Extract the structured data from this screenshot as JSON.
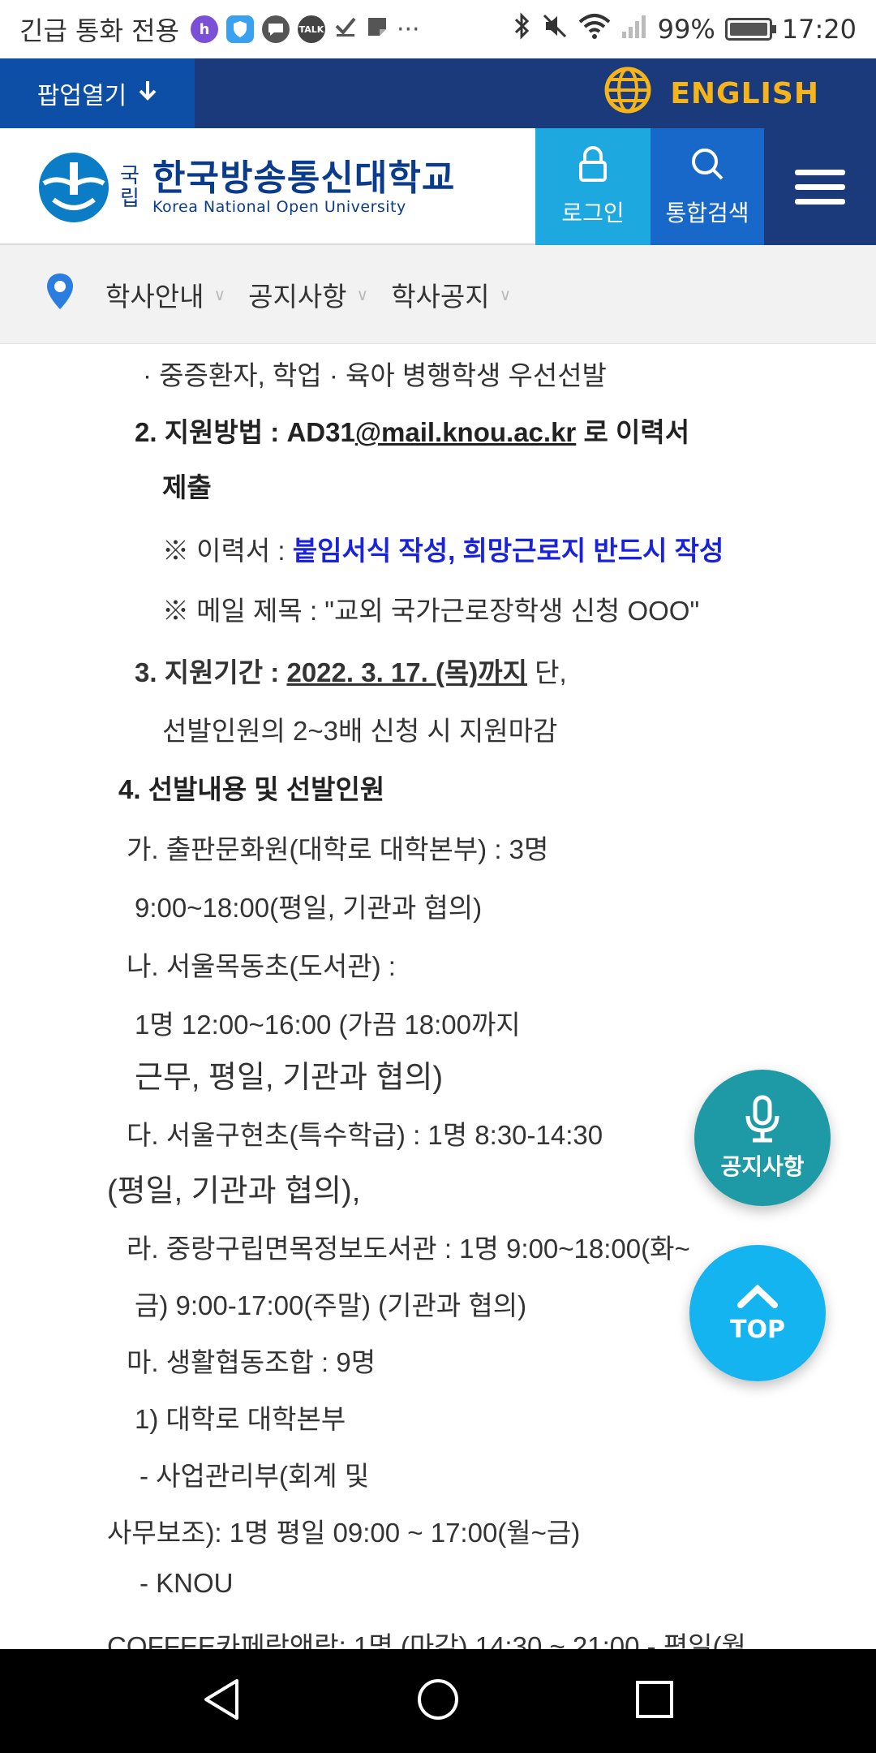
{
  "status_bar": {
    "carrier": "긴급 통화 전용",
    "battery": "99%",
    "time": "17:20",
    "battery_level": 0.99
  },
  "topbar": {
    "popup_label": "팝업열기",
    "english_label": "ENGLISH"
  },
  "header": {
    "logo_gukrip": "국립",
    "logo_name": "한국방송통신대학교",
    "logo_sub": "Korea National Open University",
    "login_label": "로그인",
    "search_label": "통합검색"
  },
  "breadcrumb": {
    "items": [
      "학사안내",
      "공지사항",
      "학사공지"
    ]
  },
  "content": {
    "l1": "· 중증환자, 학업 · 육아 병행학생 우선선발",
    "l2a": "2. 지원방법 : AD31",
    "l2b": "@mail.knou.ac.kr",
    "l2c": " 로 이력서",
    "l3": "제출",
    "l4a": "※ 이력서 : ",
    "l4b": "붙임서식 작성, 희망근로지 반드시 작성",
    "l5": "※ 메일 제목 : \"교외 국가근로장학생 신청 OOO\"",
    "l6a": "3. 지원기간 : ",
    "l6b": "2022. 3. 17. (목)까지",
    "l6c": " 단,",
    "l7": "선발인원의 2~3배 신청 시 지원마감",
    "l8": "4. 선발내용 및 선발인원",
    "l9": "가. 출판문화원(대학로 대학본부) : 3명",
    "l10": "9:00~18:00(평일, 기관과 협의)",
    "l11": "나. 서울목동초(도서관) :",
    "l12": "1명  12:00~16:00 (가끔 18:00까지",
    "l13": "근무, 평일, 기관과 협의)",
    "l14": "다. 서울구현초(특수학급)  : 1명  8:30-14:30",
    "l15": "(평일, 기관과 협의),",
    "l16": "라. 중랑구립면목정보도서관 : 1명  9:00~18:00(화~",
    "l17": "금) 9:00-17:00(주말)  (기관과 협의)",
    "l18": "마. 생활협동조합 : 9명",
    "l19": "1) 대학로 대학본부",
    "l20": "- 사업관리부(회계 및",
    "l21": "사무보조): 1명 평일 09:00 ~ 17:00(월~금)",
    "l22": "- KNOU",
    "l23": "COFFEE카페락앤락: 1명 (마감) 14:30 ~ 21:00 - 평일(월"
  },
  "floating": {
    "notice_label": "공지사항",
    "top_label": "TOP"
  },
  "icons": [
    "h-icon",
    "shield-icon",
    "chat-icon",
    "talk-icon",
    "check-icon",
    "note-icon",
    "more-icon",
    "bluetooth-icon",
    "mute-icon",
    "wifi-icon",
    "signal-icon",
    "battery-icon",
    "arrow-down-icon",
    "globe-icon",
    "lock-icon",
    "search-icon",
    "menu-icon",
    "location-pin-icon",
    "microphone-icon",
    "chevron-up-icon",
    "back-icon",
    "home-icon",
    "recents-icon"
  ],
  "colors": {
    "topbar": "#1b3a7b",
    "popup": "#0d4ea6",
    "english": "#f4b41a",
    "login": "#1ea8e0",
    "search": "#1868c9",
    "notice_fab": "#1d9aa5",
    "top_fab": "#14b4f0",
    "highlight_text": "#1a23d9"
  }
}
